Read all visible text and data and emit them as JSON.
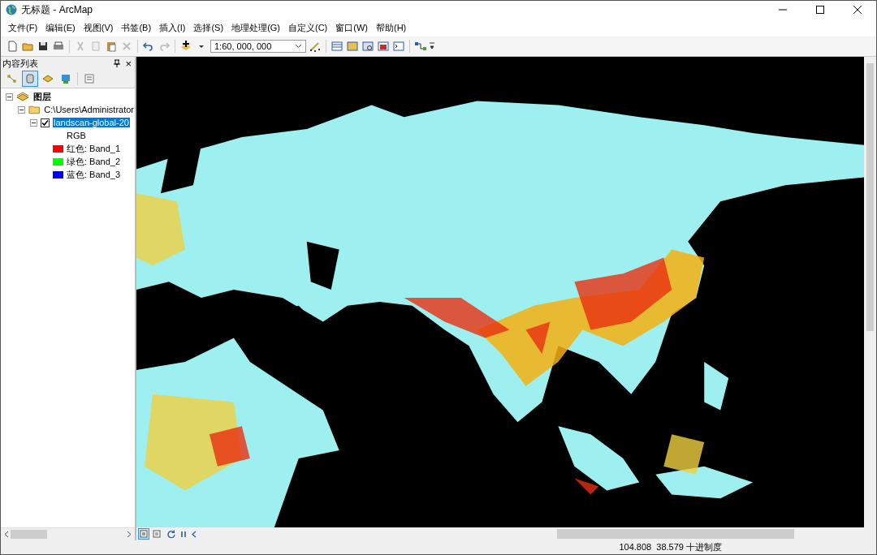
{
  "window": {
    "title": "无标题 - ArcMap"
  },
  "menu": [
    "文件(F)",
    "编辑(E)",
    "视图(V)",
    "书签(B)",
    "插入(I)",
    "选择(S)",
    "地理处理(G)",
    "自定义(C)",
    "窗口(W)",
    "帮助(H)"
  ],
  "scale": {
    "value": "1:60, 000, 000"
  },
  "toc": {
    "title": "内容列表",
    "close": "×",
    "tabs": [
      {
        "selected": false
      },
      {
        "selected": true
      },
      {
        "selected": false
      },
      {
        "selected": false
      },
      {
        "selected": false
      }
    ],
    "tree": [
      {
        "label": "图层",
        "kind": "frame",
        "expanded": true,
        "children": [
          {
            "label": "C:\\Users\\Administrator",
            "kind": "folder",
            "expanded": true,
            "children": [
              {
                "label": "landscan-global-20",
                "kind": "layer",
                "expanded": true,
                "checked": true,
                "selected": true,
                "renderer": "RGB",
                "legend": [
                  {
                    "channel": "红色:",
                    "band": "Band_1",
                    "color": "#ff0000"
                  },
                  {
                    "channel": "绿色:",
                    "band": "Band_2",
                    "color": "#00ff00"
                  },
                  {
                    "channel": "蓝色:",
                    "band": "Band_3",
                    "color": "#0000ff"
                  }
                ]
              }
            ]
          }
        ]
      }
    ]
  },
  "view_buttons": [
    {
      "selected": true
    },
    {
      "selected": false
    }
  ],
  "status_bar": {
    "coordinates": "104.808  38.579 十进制度"
  }
}
